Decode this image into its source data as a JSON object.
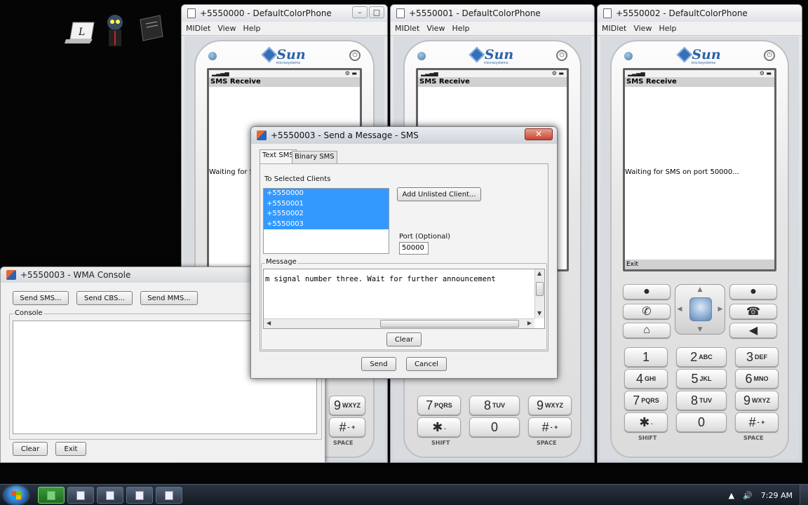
{
  "emulators": [
    {
      "title": "+5550000 - DefaultColorPhone",
      "menu": [
        "MIDlet",
        "View",
        "Help"
      ],
      "screen_title": "SMS Receive",
      "screen_message": "Waiting for SMS on port 50000...",
      "soft_left": ""
    },
    {
      "title": "+5550001 - DefaultColorPhone",
      "menu": [
        "MIDlet",
        "View",
        "Help"
      ],
      "screen_title": "SMS Receive",
      "screen_message": "",
      "soft_left": ""
    },
    {
      "title": "+5550002 - DefaultColorPhone",
      "menu": [
        "MIDlet",
        "View",
        "Help"
      ],
      "screen_title": "SMS Receive",
      "screen_message": "Waiting for SMS on port 50000...",
      "soft_left": "Exit"
    }
  ],
  "phone": {
    "brand": "Sun",
    "brand_sub": "microsystems",
    "keys": [
      {
        "digit": "1",
        "letters": ""
      },
      {
        "digit": "2",
        "letters": "ABC"
      },
      {
        "digit": "3",
        "letters": "DEF"
      },
      {
        "digit": "4",
        "letters": "GHI"
      },
      {
        "digit": "5",
        "letters": "JKL"
      },
      {
        "digit": "6",
        "letters": "MNO"
      },
      {
        "digit": "7",
        "letters": "PQRS"
      },
      {
        "digit": "8",
        "letters": "TUV"
      },
      {
        "digit": "9",
        "letters": "WXYZ"
      },
      {
        "digit": "✱",
        "letters": "."
      },
      {
        "digit": "0",
        "letters": ""
      },
      {
        "digit": "#",
        "letters": "- +"
      }
    ],
    "shift_label": "SHIFT",
    "space_label": "SPACE"
  },
  "console": {
    "title": "+5550003 - WMA Console",
    "buttons": {
      "send_sms": "Send SMS...",
      "send_cbs": "Send CBS...",
      "send_mms": "Send MMS..."
    },
    "console_label": "Console",
    "clear_label": "Clear",
    "exit_label": "Exit"
  },
  "dialog": {
    "title": "+5550003 - Send a Message - SMS",
    "tabs": [
      "Text SMS",
      "Binary SMS"
    ],
    "to_label": "To Selected Clients",
    "clients": [
      "+5550000",
      "+5550001",
      "+5550002",
      "+5550003"
    ],
    "add_client_label": "Add Unlisted Client...",
    "port_label": "Port (Optional)",
    "port_value": "50000",
    "message_label": "Message",
    "message_text": "m signal number three. Wait for further announcement",
    "clear_label": "Clear",
    "send_label": "Send",
    "cancel_label": "Cancel"
  },
  "taskbar": {
    "time": "7:29 AM"
  }
}
